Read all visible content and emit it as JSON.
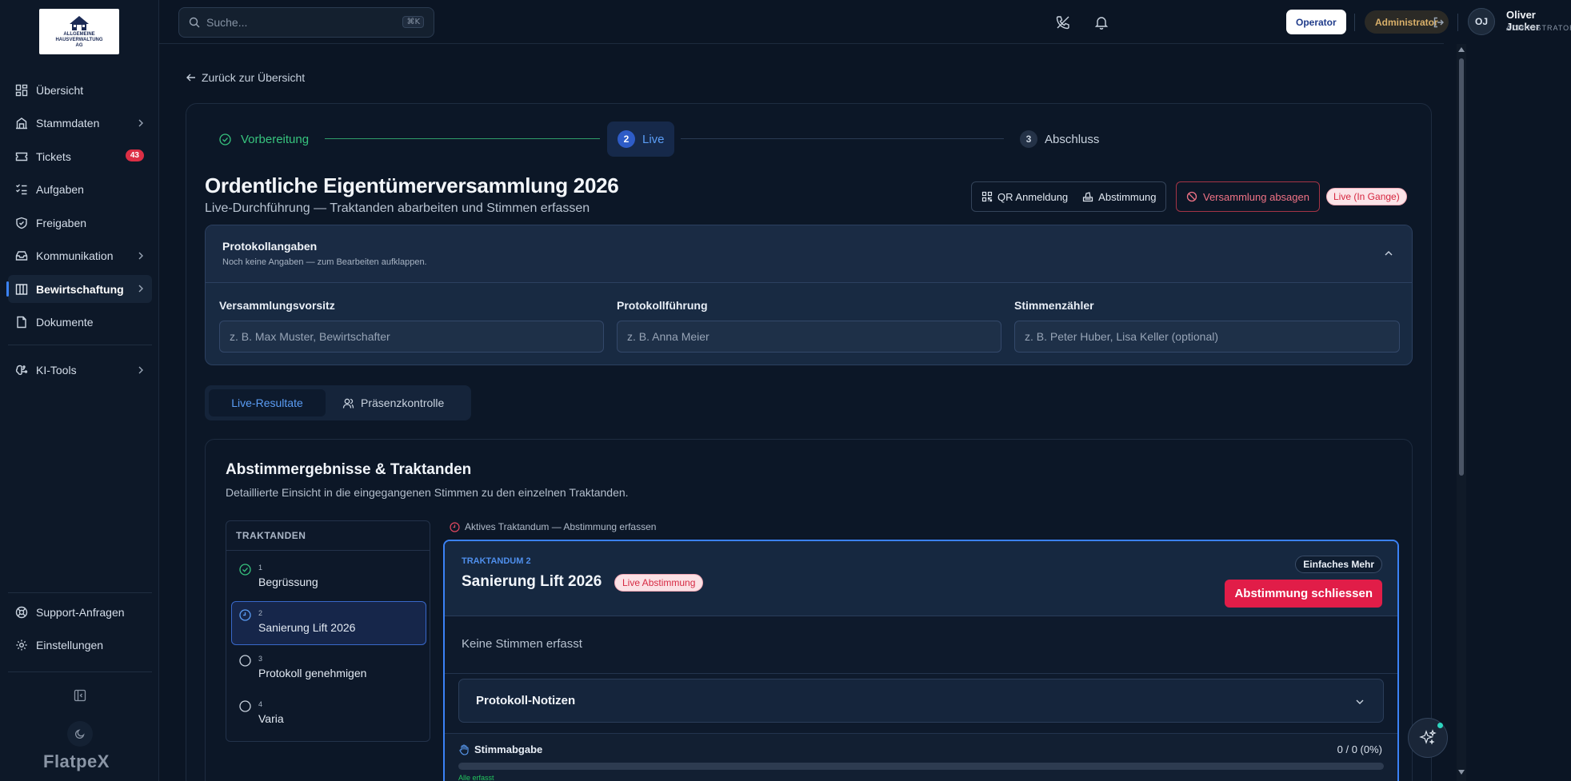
{
  "sidebar": {
    "logo_text_line1": "ALLGEMEINE",
    "logo_text_line2": "HAUSVERWALTUNG",
    "logo_text_line3": "AG",
    "items": [
      {
        "label": "Übersicht",
        "icon": "grid-icon"
      },
      {
        "label": "Stammdaten",
        "icon": "building-icon",
        "has_children": true
      },
      {
        "label": "Tickets",
        "icon": "ticket-icon",
        "badge": "43"
      },
      {
        "label": "Aufgaben",
        "icon": "checklist-icon"
      },
      {
        "label": "Freigaben",
        "icon": "shield-icon"
      },
      {
        "label": "Kommunikation",
        "icon": "mail-icon",
        "has_children": true
      },
      {
        "label": "Bewirtschaftung",
        "icon": "columns-icon",
        "has_children": true,
        "active": true
      },
      {
        "label": "Dokumente",
        "icon": "document-icon"
      }
    ],
    "ki_tools": "KI-Tools",
    "support": "Support-Anfragen",
    "settings": "Einstellungen",
    "brand": "FlatpeX"
  },
  "topbar": {
    "search_placeholder": "Suche...",
    "search_shortcut": "⌘K",
    "operator_label": "Operator",
    "admin_label": "Administrator",
    "avatar_initials": "OJ",
    "user_name": "Oliver Jucker",
    "user_role": "ADMINISTRATOR"
  },
  "page": {
    "back_link": "Zurück zur Übersicht",
    "steps": [
      {
        "num": "1",
        "label": "Vorbereitung",
        "state": "done"
      },
      {
        "num": "2",
        "label": "Live",
        "state": "current"
      },
      {
        "num": "3",
        "label": "Abschluss",
        "state": "pending"
      }
    ],
    "title": "Ordentliche Eigentümerversammlung 2026",
    "subtitle": "Live-Durchführung — Traktanden abarbeiten und Stimmen erfassen",
    "qr_label": "QR Anmeldung",
    "vote_label": "Abstimmung",
    "cancel_label": "Versammlung absagen",
    "live_badge": "Live (In Gange)"
  },
  "protocol": {
    "title": "Protokollangaben",
    "hint": "Noch keine Angaben — zum Bearbeiten aufklappen.",
    "fields": [
      {
        "label": "Versammlungsvorsitz",
        "placeholder": "z. B. Max Muster, Bewirtschafter"
      },
      {
        "label": "Protokollführung",
        "placeholder": "z. B. Anna Meier"
      },
      {
        "label": "Stimmenzähler",
        "placeholder": "z. B. Peter Huber, Lisa Keller (optional)"
      }
    ]
  },
  "tabs": {
    "live_results": "Live-Resultate",
    "presence": "Präsenzkontrolle"
  },
  "results": {
    "title": "Abstimmergebnisse & Traktanden",
    "subtitle": "Detaillierte Einsicht in die eingegangenen Stimmen zu den einzelnen Traktanden.",
    "list_header": "TRAKTANDEN",
    "items": [
      {
        "num": "1",
        "name": "Begrüssung",
        "state": "done"
      },
      {
        "num": "2",
        "name": "Sanierung Lift 2026",
        "state": "active"
      },
      {
        "num": "3",
        "name": "Protokoll genehmigen",
        "state": "open"
      },
      {
        "num": "4",
        "name": "Varia",
        "state": "open"
      }
    ],
    "active_hint": "Aktives Traktandum — Abstimmung erfassen"
  },
  "vote": {
    "label": "TRAKTANDUM 2",
    "title": "Sanierung Lift 2026",
    "live_badge": "Live Abstimmung",
    "majority": "Einfaches Mehr",
    "close_button": "Abstimmung schliessen",
    "no_votes": "Keine Stimmen erfasst",
    "notes_title": "Protokoll-Notizen",
    "stimm_label": "Stimmabgabe",
    "stimm_count": "0 / 0 (0%)",
    "stimm_progress": 0,
    "stimm_note": "Alle erfasst"
  },
  "colors": {
    "accent": "#3b82f6",
    "danger": "#e11d48",
    "success": "#22c55e"
  }
}
